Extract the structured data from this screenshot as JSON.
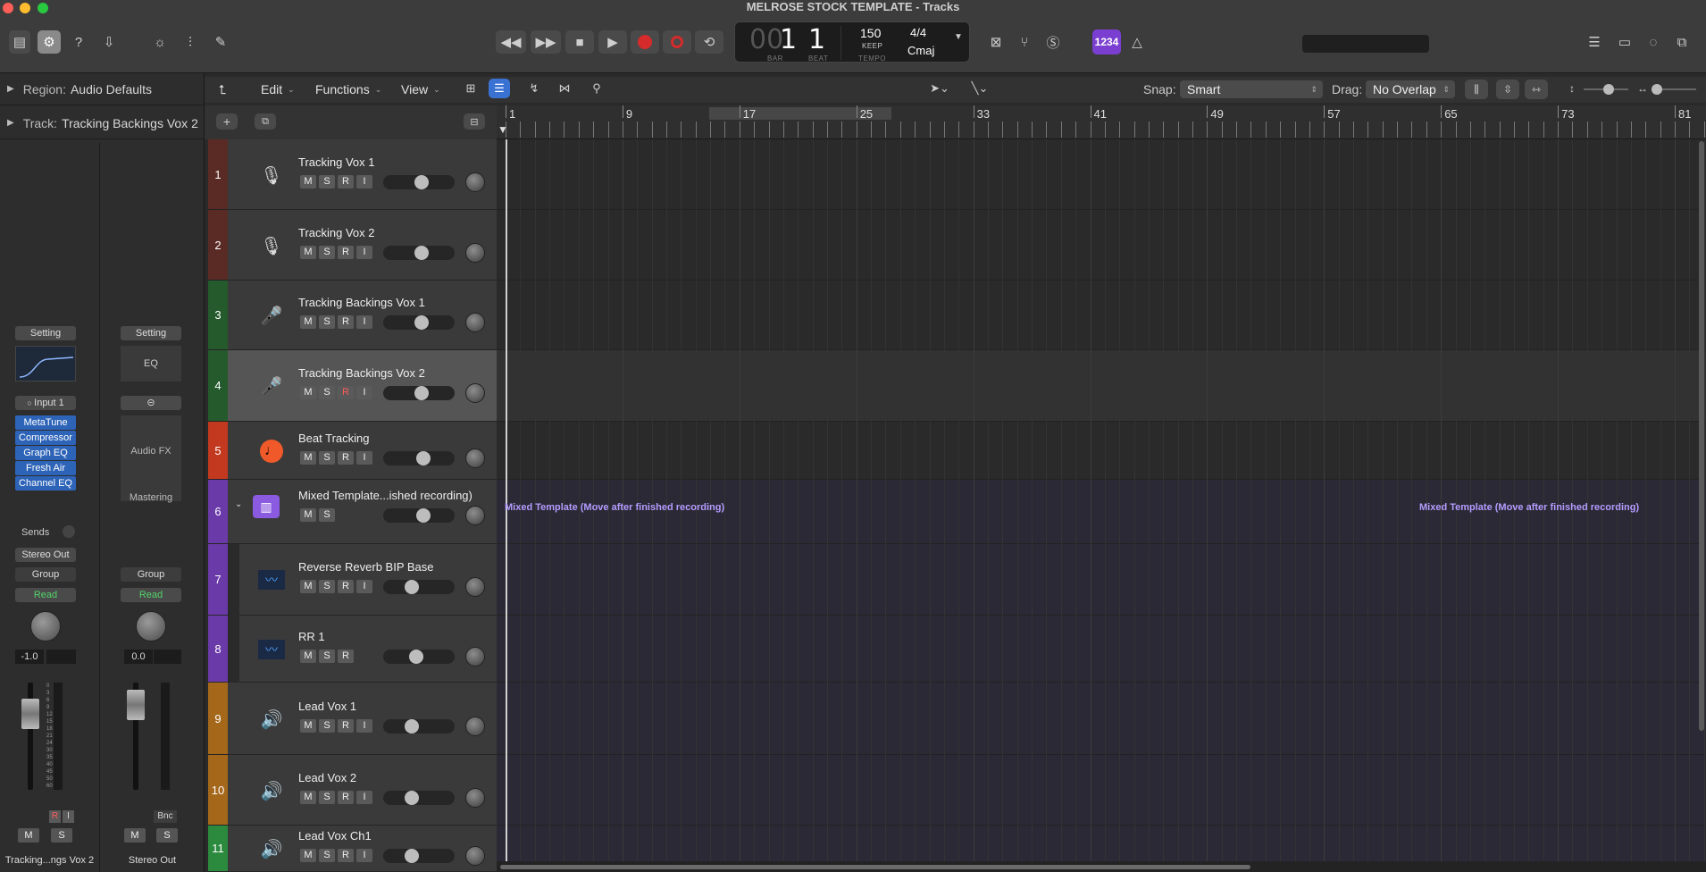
{
  "window": {
    "title": "MELROSE STOCK TEMPLATE - Tracks"
  },
  "lcd": {
    "bar_dim": "00",
    "bar": "1",
    "beat": "1",
    "bar_label": "BAR",
    "beat_label": "BEAT",
    "tempo": "150",
    "tempo_mode": "KEEP",
    "tempo_label": "TEMPO",
    "signature": "4/4",
    "key": "Cmaj"
  },
  "count_in": "1234",
  "toolbar": {
    "edit": "Edit",
    "functions": "Functions",
    "view": "View",
    "snap_label": "Snap:",
    "snap_value": "Smart",
    "drag_label": "Drag:",
    "drag_value": "No Overlap"
  },
  "inspector": {
    "region_label": "Region:",
    "region_value": "Audio Defaults",
    "track_label": "Track:",
    "track_value": "Tracking Backings Vox 2",
    "strip1": {
      "setting": "Setting",
      "input": "Input 1",
      "plugins": [
        "MetaTune",
        "Compressor",
        "Graph EQ",
        "Fresh Air",
        "Channel EQ"
      ],
      "sends": "Sends",
      "output": "Stereo Out",
      "group": "Group",
      "automation": "Read",
      "volume": "-1.0",
      "rec": "R",
      "input_mon": "I",
      "mute": "M",
      "solo": "S",
      "name": "Tracking...ngs Vox 2"
    },
    "strip2": {
      "setting": "Setting",
      "eq": "EQ",
      "audio_fx": "Audio FX",
      "mastering": "Mastering",
      "group": "Group",
      "automation": "Read",
      "volume": "0.0",
      "bounce": "Bnc",
      "mute": "M",
      "solo": "S",
      "name": "Stereo Out"
    },
    "meter_scale": [
      "0",
      "3",
      "6",
      "9",
      "12",
      "15",
      "18",
      "21",
      "24",
      "30",
      "35",
      "40",
      "45",
      "50",
      "60"
    ]
  },
  "tracks": [
    {
      "num": "1",
      "name": "Tracking Vox 1",
      "color": "#5a2a24",
      "icon": "microphone-icon",
      "buttons": [
        "M",
        "S",
        "R",
        "I"
      ],
      "vol": 0.55
    },
    {
      "num": "2",
      "name": "Tracking Vox 2",
      "color": "#5a2a24",
      "icon": "microphone-icon",
      "buttons": [
        "M",
        "S",
        "R",
        "I"
      ],
      "vol": 0.55
    },
    {
      "num": "3",
      "name": "Tracking Backings Vox 1",
      "color": "#245a2c",
      "icon": "stand-microphone-icon",
      "buttons": [
        "M",
        "S",
        "R",
        "I"
      ],
      "vol": 0.55
    },
    {
      "num": "4",
      "name": "Tracking Backings Vox 2",
      "color": "#245a2c",
      "icon": "stand-microphone-icon",
      "buttons": [
        "M",
        "S",
        "R",
        "I"
      ],
      "vol": 0.55,
      "selected": true,
      "rec_armed": true
    },
    {
      "num": "5",
      "name": "Beat Tracking",
      "color": "#c2391f",
      "icon": "metronome-note-icon",
      "buttons": [
        "M",
        "S",
        "R",
        "I"
      ],
      "vol": 0.58
    },
    {
      "num": "6",
      "name": "Mixed Template...ished recording)",
      "color": "#6a3aa8",
      "icon": "summing-stack-icon",
      "buttons": [
        "M",
        "S"
      ],
      "vol": 0.58,
      "folder": true
    },
    {
      "num": "7",
      "name": "Reverse Reverb BIP Base",
      "color": "#6a3aa8",
      "icon": "waveform-icon",
      "buttons": [
        "M",
        "S",
        "R",
        "I"
      ],
      "vol": 0.37
    },
    {
      "num": "8",
      "name": "RR 1",
      "color": "#6a3aa8",
      "icon": "waveform-icon",
      "buttons": [
        "M",
        "S",
        "R"
      ],
      "vol": 0.45
    },
    {
      "num": "9",
      "name": "Lead Vox 1",
      "color": "#a5681b",
      "icon": "speaker-icon",
      "buttons": [
        "M",
        "S",
        "R",
        "I"
      ],
      "vol": 0.37
    },
    {
      "num": "10",
      "name": "Lead Vox 2",
      "color": "#a5681b",
      "icon": "speaker-icon",
      "buttons": [
        "M",
        "S",
        "R",
        "I"
      ],
      "vol": 0.37
    },
    {
      "num": "11",
      "name": "Lead Vox Ch1",
      "color": "#2b8a3e",
      "icon": "speaker-icon",
      "buttons": [
        "M",
        "S",
        "R",
        "I"
      ],
      "vol": 0.37
    }
  ],
  "ruler": {
    "bars": [
      "1",
      "9",
      "17",
      "25",
      "33",
      "41",
      "49",
      "57",
      "65",
      "73",
      "81"
    ]
  },
  "regions": {
    "folder_label_1": "Mixed Template (Move after finished recording)",
    "folder_label_2": "Mixed Template (Move after finished recording)"
  },
  "colors": {
    "accent": "#2e64b8",
    "record": "#d52b2b",
    "region_purple": "#b49cff",
    "count_in": "#7a3fd0"
  }
}
